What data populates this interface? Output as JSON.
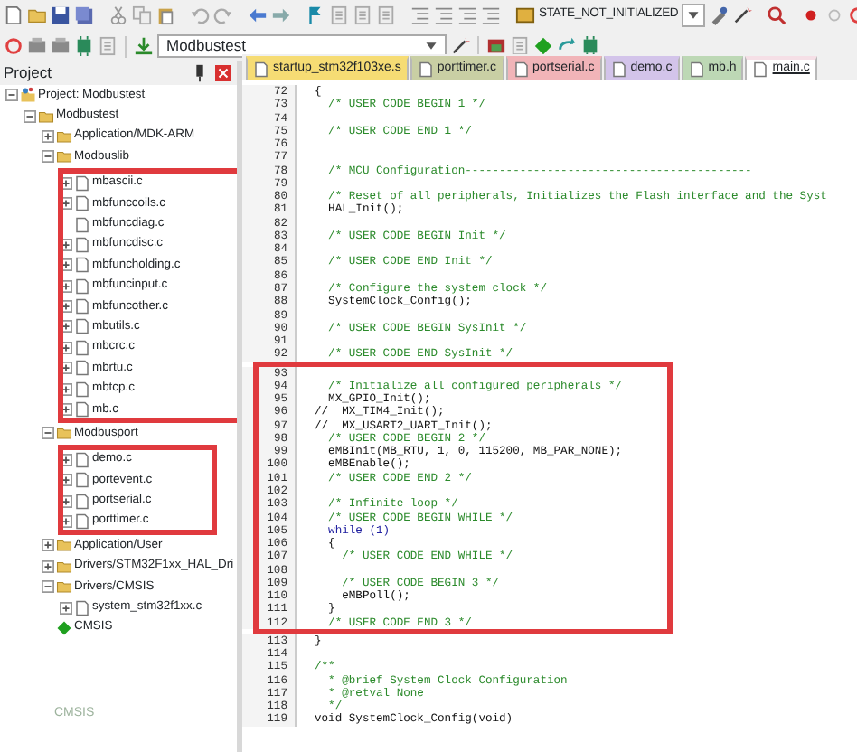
{
  "toolbar": {
    "debug_state": "STATE_NOT_INITIALIZED",
    "target": "Modbustest"
  },
  "project_panel": {
    "title": "Project",
    "tree": [
      {
        "label": "Project: Modbustest",
        "kind": "project",
        "expanded": true,
        "children": [
          {
            "label": "Modbustest",
            "kind": "folder",
            "expanded": true,
            "children": [
              {
                "label": "Application/MDK-ARM",
                "kind": "folder",
                "expanded": false
              },
              {
                "label": "Modbuslib",
                "kind": "folder",
                "expanded": true,
                "highlight": true,
                "children": [
                  {
                    "label": "mbascii.c",
                    "kind": "file",
                    "expanded": false
                  },
                  {
                    "label": "mbfunccoils.c",
                    "kind": "file",
                    "expanded": false
                  },
                  {
                    "label": "mbfuncdiag.c",
                    "kind": "file"
                  },
                  {
                    "label": "mbfuncdisc.c",
                    "kind": "file",
                    "expanded": false
                  },
                  {
                    "label": "mbfuncholding.c",
                    "kind": "file",
                    "expanded": false
                  },
                  {
                    "label": "mbfuncinput.c",
                    "kind": "file",
                    "expanded": false
                  },
                  {
                    "label": "mbfuncother.c",
                    "kind": "file",
                    "expanded": false
                  },
                  {
                    "label": "mbutils.c",
                    "kind": "file",
                    "expanded": false
                  },
                  {
                    "label": "mbcrc.c",
                    "kind": "file",
                    "expanded": false
                  },
                  {
                    "label": "mbrtu.c",
                    "kind": "file",
                    "expanded": false
                  },
                  {
                    "label": "mbtcp.c",
                    "kind": "file",
                    "expanded": false
                  },
                  {
                    "label": "mb.c",
                    "kind": "file",
                    "expanded": false
                  }
                ]
              },
              {
                "label": "Modbusport",
                "kind": "folder",
                "expanded": true,
                "highlight": true,
                "children": [
                  {
                    "label": "demo.c",
                    "kind": "file",
                    "expanded": false
                  },
                  {
                    "label": "portevent.c",
                    "kind": "file",
                    "expanded": false
                  },
                  {
                    "label": "portserial.c",
                    "kind": "file",
                    "expanded": false
                  },
                  {
                    "label": "porttimer.c",
                    "kind": "file",
                    "expanded": false
                  }
                ]
              },
              {
                "label": "Application/User",
                "kind": "folder",
                "expanded": false
              },
              {
                "label": "Drivers/STM32F1xx_HAL_Dri",
                "kind": "folder",
                "expanded": false
              },
              {
                "label": "Drivers/CMSIS",
                "kind": "folder",
                "expanded": true,
                "children": [
                  {
                    "label": "system_stm32f1xx.c",
                    "kind": "file",
                    "expanded": false
                  }
                ]
              },
              {
                "label": "CMSIS",
                "kind": "component"
              }
            ]
          }
        ]
      }
    ],
    "faded_label": "CMSIS"
  },
  "editor": {
    "tabs": [
      {
        "label": "startup_stm32f103xe.s",
        "color": "#f6dc74",
        "selected": false
      },
      {
        "label": "porttimer.c",
        "color": "#c9cfa4",
        "selected": false
      },
      {
        "label": "portserial.c",
        "color": "#f1b4b8",
        "selected": false
      },
      {
        "label": "demo.c",
        "color": "#d3c4ea",
        "selected": false
      },
      {
        "label": "mb.h",
        "color": "#bdd8b5",
        "selected": false
      },
      {
        "label": "main.c",
        "color": "#f5dfe6",
        "selected": true
      }
    ],
    "blocks": [
      {
        "lines": [
          {
            "number": "72",
            "kind": "code",
            "text": "{"
          },
          {
            "number": "73",
            "kind": "comment",
            "text": "  /* USER CODE BEGIN 1 */"
          },
          {
            "number": "74",
            "kind": "blank"
          },
          {
            "number": "75",
            "kind": "comment",
            "text": "  /* USER CODE END 1 */"
          },
          {
            "number": "76",
            "kind": "blank"
          },
          {
            "number": "77",
            "kind": "blank"
          },
          {
            "number": "78",
            "kind": "comment",
            "text": "  /* MCU Configuration------------------------------------------"
          },
          {
            "number": "79",
            "kind": "blank"
          },
          {
            "number": "80",
            "kind": "comment",
            "text": "  /* Reset of all peripherals, Initializes the Flash interface and the Syst"
          },
          {
            "number": "81",
            "kind": "code",
            "text": "  HAL_Init();"
          },
          {
            "number": "82",
            "kind": "blank"
          },
          {
            "number": "83",
            "kind": "comment",
            "text": "  /* USER CODE BEGIN Init */"
          },
          {
            "number": "84",
            "kind": "blank"
          },
          {
            "number": "85",
            "kind": "comment",
            "text": "  /* USER CODE END Init */"
          },
          {
            "number": "86",
            "kind": "blank"
          },
          {
            "number": "87",
            "kind": "comment",
            "text": "  /* Configure the system clock */"
          },
          {
            "number": "88",
            "kind": "code",
            "text": "  SystemClock_Config();"
          },
          {
            "number": "89",
            "kind": "blank"
          },
          {
            "number": "90",
            "kind": "comment",
            "text": "  /* USER CODE BEGIN SysInit */"
          },
          {
            "number": "91",
            "kind": "blank"
          },
          {
            "number": "92",
            "kind": "comment",
            "text": "  /* USER CODE END SysInit */"
          }
        ]
      },
      {
        "highlight": true,
        "lines": [
          {
            "number": "93",
            "kind": "blank"
          },
          {
            "number": "94",
            "kind": "comment",
            "text": "  /* Initialize all configured peripherals */"
          },
          {
            "number": "95",
            "kind": "code",
            "text": "  MX_GPIO_Init();"
          },
          {
            "number": "96",
            "kind": "code",
            "text": "//  MX_TIM4_Init();"
          },
          {
            "number": "97",
            "kind": "code",
            "text": "//  MX_USART2_UART_Init();"
          },
          {
            "number": "98",
            "kind": "comment",
            "text": "  /* USER CODE BEGIN 2 */"
          },
          {
            "number": "99",
            "kind": "code",
            "text": "  eMBInit(MB_RTU, 1, 0, 115200, MB_PAR_NONE);"
          },
          {
            "number": "100",
            "kind": "code",
            "text": "  eMBEnable();"
          },
          {
            "number": "101",
            "kind": "comment",
            "text": "  /* USER CODE END 2 */"
          },
          {
            "number": "102",
            "kind": "blank"
          },
          {
            "number": "103",
            "kind": "comment",
            "text": "  /* Infinite loop */"
          },
          {
            "number": "104",
            "kind": "comment",
            "text": "  /* USER CODE BEGIN WHILE */"
          },
          {
            "number": "105",
            "kind": "keyword",
            "text": "  while (1)"
          },
          {
            "number": "106",
            "kind": "code",
            "text": "  {"
          },
          {
            "number": "107",
            "kind": "comment",
            "text": "    /* USER CODE END WHILE */"
          },
          {
            "number": "108",
            "kind": "blank"
          },
          {
            "number": "109",
            "kind": "comment",
            "text": "    /* USER CODE BEGIN 3 */"
          },
          {
            "number": "110",
            "kind": "code",
            "text": "    eMBPoll();"
          },
          {
            "number": "111",
            "kind": "code",
            "text": "  }"
          },
          {
            "number": "112",
            "kind": "comment",
            "text": "  /* USER CODE END 3 */"
          }
        ]
      },
      {
        "lines": [
          {
            "number": "113",
            "kind": "code",
            "text": "}"
          },
          {
            "number": "114",
            "kind": "blank"
          },
          {
            "number": "115",
            "kind": "comment",
            "text": "/**"
          },
          {
            "number": "116",
            "kind": "comment",
            "text": "  * @brief System Clock Configuration"
          },
          {
            "number": "117",
            "kind": "comment",
            "text": "  * @retval None"
          },
          {
            "number": "118",
            "kind": "comment",
            "text": "  */"
          },
          {
            "number": "119",
            "kind": "code",
            "text": "void SystemClock_Config(void)"
          }
        ]
      }
    ]
  }
}
